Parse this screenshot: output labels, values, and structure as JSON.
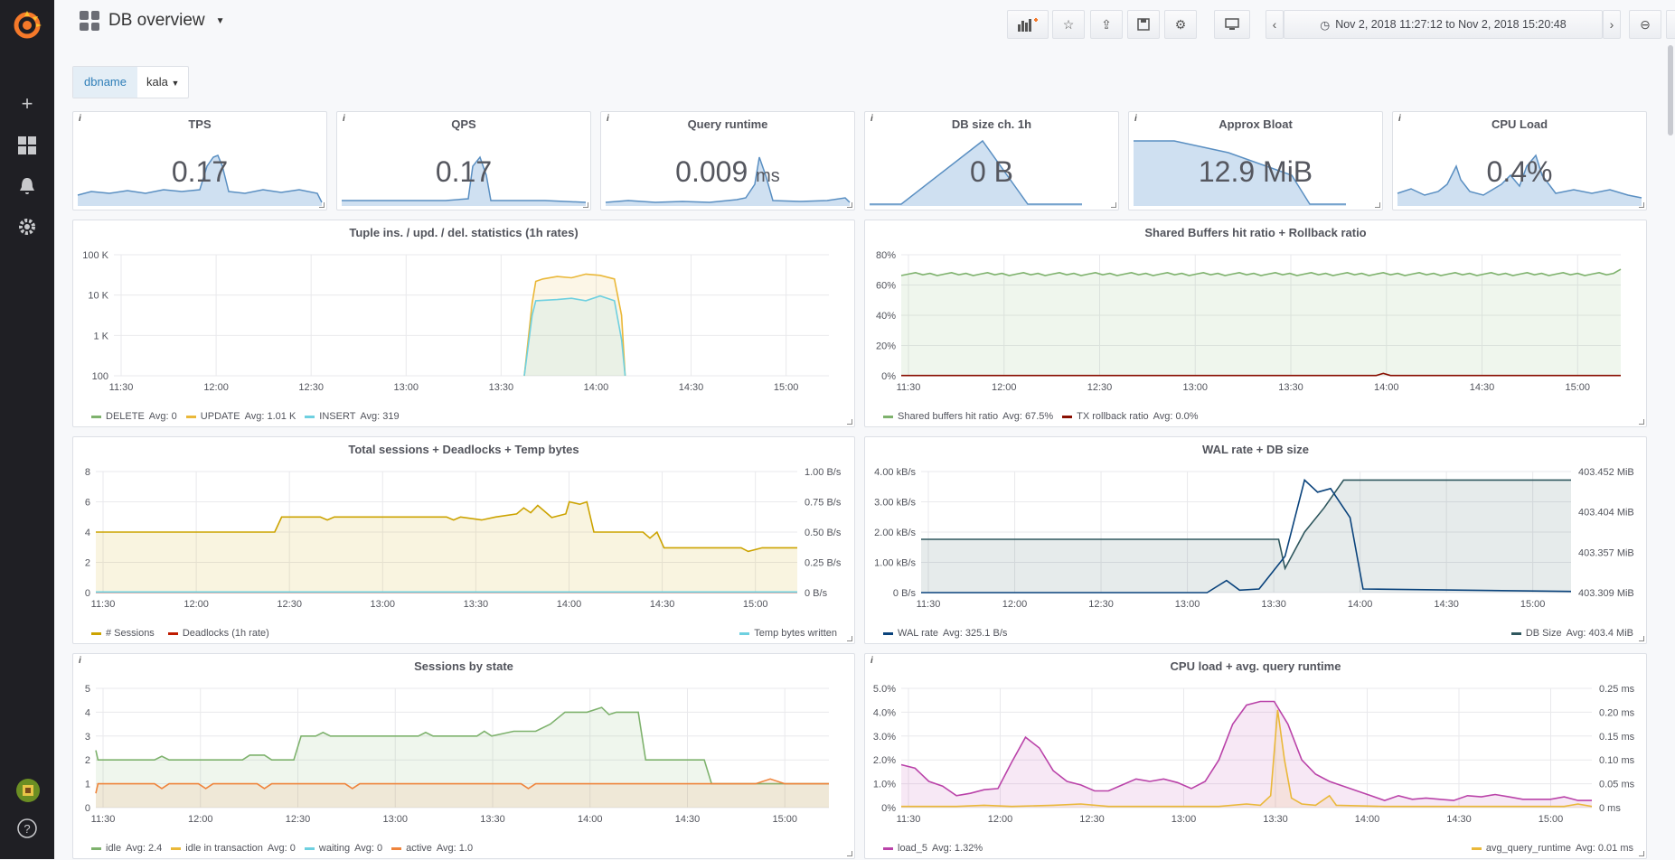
{
  "dashboard": {
    "title": "DB overview"
  },
  "toolbar": {
    "time_range": "Nov 2, 2018 11:27:12 to Nov 2, 2018 15:20:48"
  },
  "variables": [
    {
      "label": "dbname",
      "value": "kala"
    }
  ],
  "stats": [
    {
      "title": "TPS",
      "value": "0.17",
      "unit": ""
    },
    {
      "title": "QPS",
      "value": "0.17",
      "unit": ""
    },
    {
      "title": "Query runtime",
      "value": "0.009",
      "unit": "ms"
    },
    {
      "title": "DB size ch. 1h",
      "value": "0 B",
      "unit": ""
    },
    {
      "title": "Approx Bloat",
      "value": "12.9 MiB",
      "unit": ""
    },
    {
      "title": "CPU Load",
      "value": "0.4%",
      "unit": ""
    }
  ],
  "panels": {
    "tuples": {
      "title": "Tuple ins. / upd. / del. statistics (1h rates)",
      "yticks": [
        "100 K",
        "10 K",
        "1 K",
        "100"
      ],
      "xticks": [
        "11:30",
        "12:00",
        "12:30",
        "13:00",
        "13:30",
        "14:00",
        "14:30",
        "15:00"
      ],
      "legend": [
        {
          "name": "DELETE",
          "stat": "Avg: 0",
          "color": "#7eb26d"
        },
        {
          "name": "UPDATE",
          "stat": "Avg: 1.01 K",
          "color": "#eab839"
        },
        {
          "name": "INSERT",
          "stat": "Avg: 319",
          "color": "#6ed0e0"
        }
      ]
    },
    "buffers": {
      "title": "Shared Buffers hit ratio + Rollback ratio",
      "yticks": [
        "80%",
        "60%",
        "40%",
        "20%",
        "0%"
      ],
      "xticks": [
        "11:30",
        "12:00",
        "12:30",
        "13:00",
        "13:30",
        "14:00",
        "14:30",
        "15:00"
      ],
      "legend": [
        {
          "name": "Shared buffers hit ratio",
          "stat": "Avg: 67.5%",
          "color": "#7eb26d"
        },
        {
          "name": "TX rollback ratio",
          "stat": "Avg: 0.0%",
          "color": "#890f02"
        }
      ]
    },
    "sessions": {
      "title": "Total sessions + Deadlocks + Temp bytes",
      "yticks": [
        "8",
        "6",
        "4",
        "2",
        "0"
      ],
      "yticks_right": [
        "1.00 B/s",
        "0.75 B/s",
        "0.50 B/s",
        "0.25 B/s",
        "0 B/s"
      ],
      "xticks": [
        "11:30",
        "12:00",
        "12:30",
        "13:00",
        "13:30",
        "14:00",
        "14:30",
        "15:00"
      ],
      "legend": [
        {
          "name": "# Sessions",
          "stat": "",
          "color": "#cca300"
        },
        {
          "name": "Deadlocks (1h rate)",
          "stat": "",
          "color": "#bf1b00"
        }
      ],
      "legend_right": [
        {
          "name": "Temp bytes written",
          "stat": "",
          "color": "#6ed0e0"
        }
      ]
    },
    "wal": {
      "title": "WAL rate + DB size",
      "yticks": [
        "4.00 kB/s",
        "3.00 kB/s",
        "2.00 kB/s",
        "1.00 kB/s",
        "0 B/s"
      ],
      "yticks_right": [
        "403.452 MiB",
        "403.404 MiB",
        "403.357 MiB",
        "403.309 MiB"
      ],
      "xticks": [
        "11:30",
        "12:00",
        "12:30",
        "13:00",
        "13:30",
        "14:00",
        "14:30",
        "15:00"
      ],
      "legend": [
        {
          "name": "WAL rate",
          "stat": "Avg: 325.1 B/s",
          "color": "#0a437c"
        }
      ],
      "legend_right": [
        {
          "name": "DB Size",
          "stat": "Avg: 403.4 MiB",
          "color": "#2f575e"
        }
      ]
    },
    "states": {
      "title": "Sessions by state",
      "yticks": [
        "5",
        "4",
        "3",
        "2",
        "1",
        "0"
      ],
      "xticks": [
        "11:30",
        "12:00",
        "12:30",
        "13:00",
        "13:30",
        "14:00",
        "14:30",
        "15:00"
      ],
      "legend": [
        {
          "name": "idle",
          "stat": "Avg: 2.4",
          "color": "#7eb26d"
        },
        {
          "name": "idle in transaction",
          "stat": "Avg: 0",
          "color": "#eab839"
        },
        {
          "name": "waiting",
          "stat": "Avg: 0",
          "color": "#6ed0e0"
        },
        {
          "name": "active",
          "stat": "Avg: 1.0",
          "color": "#ef843c"
        }
      ]
    },
    "cpu": {
      "title": "CPU load + avg. query runtime",
      "yticks": [
        "5.0%",
        "4.0%",
        "3.0%",
        "2.0%",
        "1.0%",
        "0%"
      ],
      "yticks_right": [
        "0.25 ms",
        "0.20 ms",
        "0.15 ms",
        "0.10 ms",
        "0.05 ms",
        "0 ms"
      ],
      "xticks": [
        "11:30",
        "12:00",
        "12:30",
        "13:00",
        "13:30",
        "14:00",
        "14:30",
        "15:00"
      ],
      "legend": [
        {
          "name": "load_5",
          "stat": "Avg: 1.32%",
          "color": "#ba43a9"
        }
      ],
      "legend_right": [
        {
          "name": "avg_query_runtime",
          "stat": "Avg: 0.01 ms",
          "color": "#eab839"
        }
      ]
    }
  }
}
